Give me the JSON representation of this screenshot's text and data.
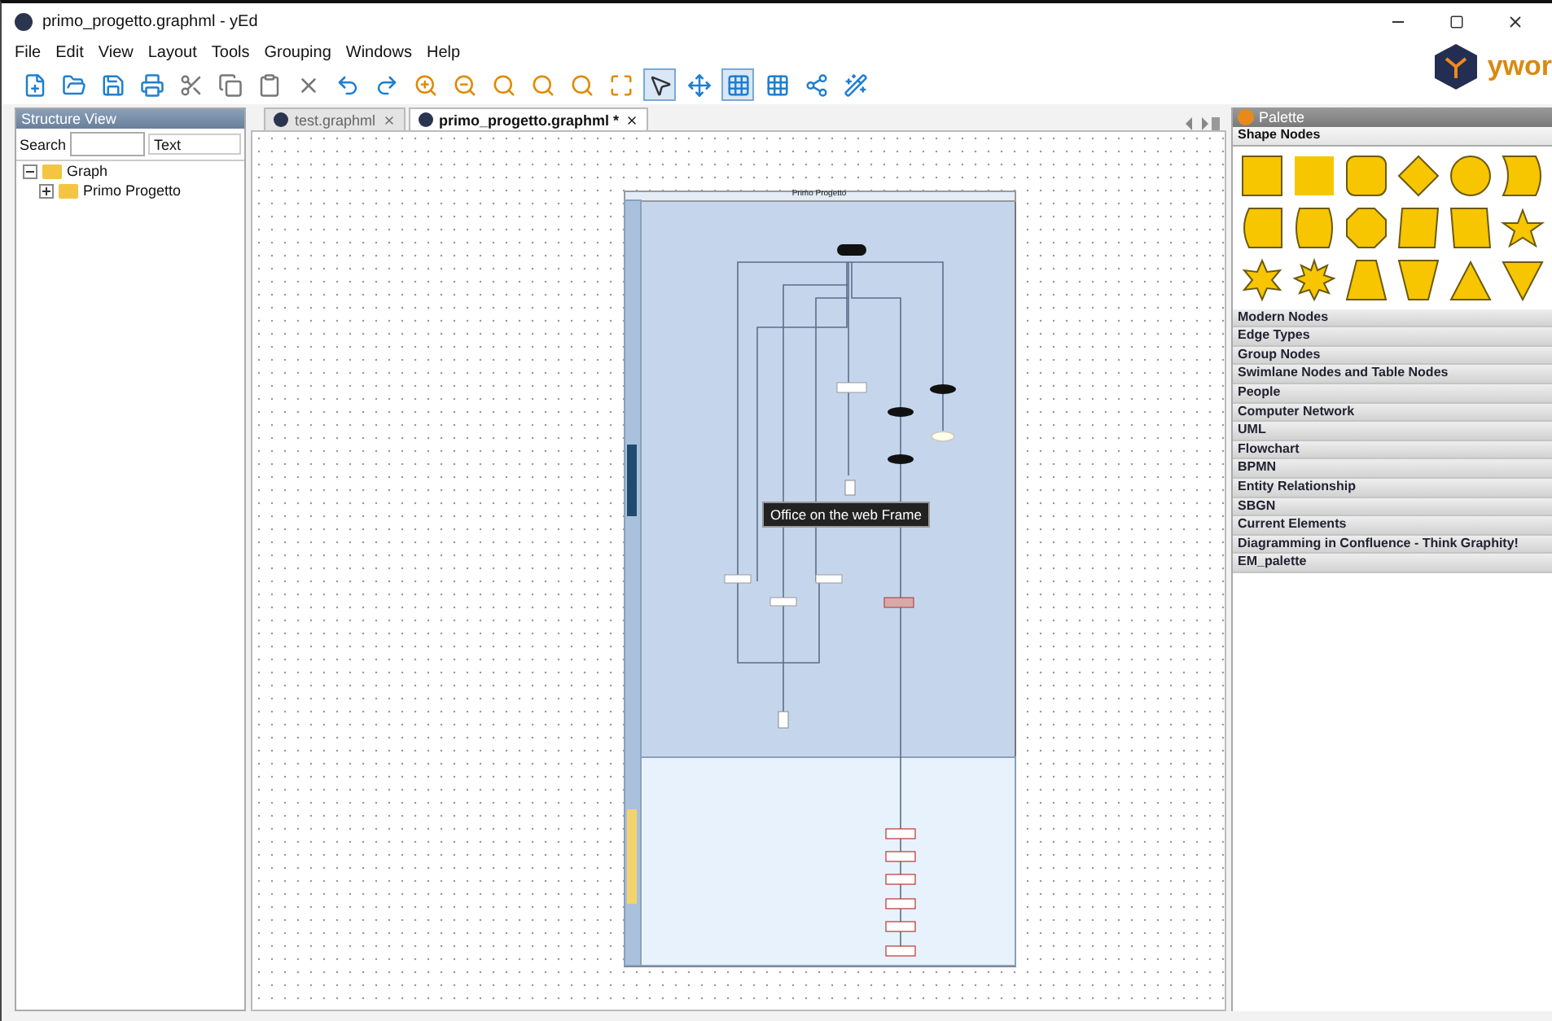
{
  "window": {
    "title": "primo_progetto.graphml - yEd"
  },
  "menu": [
    "File",
    "Edit",
    "View",
    "Layout",
    "Tools",
    "Grouping",
    "Windows",
    "Help"
  ],
  "logo": {
    "text": "ywor"
  },
  "structure_view": {
    "title": "Structure View",
    "search_label": "Search",
    "filter": "Text",
    "tree": [
      {
        "label": "Graph",
        "expanded": true,
        "children": [
          {
            "label": "Primo Progetto",
            "expanded": false
          }
        ]
      }
    ]
  },
  "tabs": [
    {
      "label": "test.graphml",
      "selected": false
    },
    {
      "label": "primo_progetto.graphml *",
      "selected": true
    }
  ],
  "diagram": {
    "title": "Primo Progetto"
  },
  "tooltip": "Office on the web Frame",
  "palette": {
    "title": "Palette",
    "sections": [
      {
        "label": "Shape Nodes",
        "expanded": true
      },
      {
        "label": "Modern Nodes",
        "expanded": false
      },
      {
        "label": "Edge Types",
        "expanded": false
      },
      {
        "label": "Group Nodes",
        "expanded": false
      },
      {
        "label": "Swimlane Nodes and Table Nodes",
        "expanded": false
      },
      {
        "label": "People",
        "expanded": false
      },
      {
        "label": "Computer Network",
        "expanded": false
      },
      {
        "label": "UML",
        "expanded": false
      },
      {
        "label": "Flowchart",
        "expanded": false
      },
      {
        "label": "BPMN",
        "expanded": false
      },
      {
        "label": "Entity Relationship",
        "expanded": false
      },
      {
        "label": "SBGN",
        "expanded": false
      },
      {
        "label": "Current Elements",
        "expanded": false
      },
      {
        "label": "Diagramming in Confluence - Think Graphity!",
        "expanded": false
      },
      {
        "label": "EM_palette",
        "expanded": false
      }
    ]
  }
}
